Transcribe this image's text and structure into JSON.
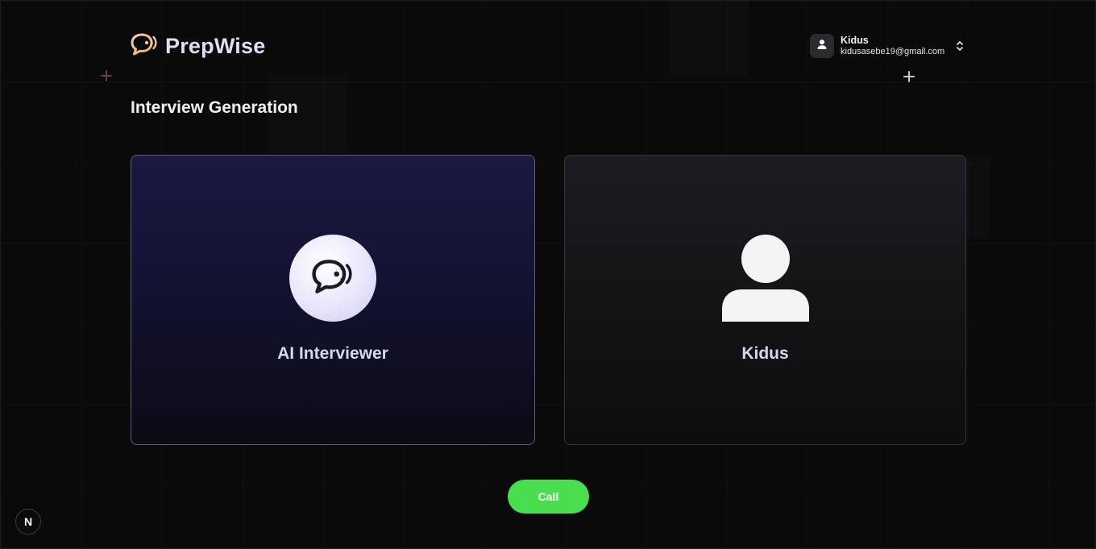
{
  "app": {
    "name": "PrepWise"
  },
  "user": {
    "name": "Kidus",
    "email": "kidusasebe19@gmail.com"
  },
  "page": {
    "title": "Interview Generation"
  },
  "cards": {
    "ai": {
      "label": "AI Interviewer",
      "icon": "chat-bubble-voice-icon"
    },
    "user": {
      "label": "Kidus",
      "icon": "user-silhouette-icon"
    }
  },
  "actions": {
    "call_label": "Call"
  },
  "dev_badge": {
    "label": "N"
  },
  "colors": {
    "background": "#0a0a0b",
    "ai_card_top": "#1b1941",
    "call_button": "#49de50",
    "logo_accent": "#f0c79a"
  }
}
